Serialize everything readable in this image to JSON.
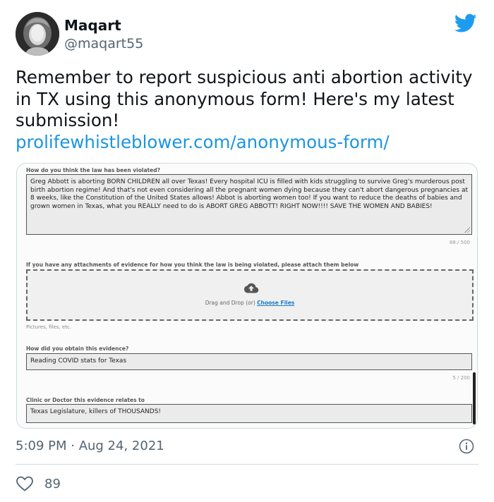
{
  "author": {
    "display_name": "Maqart",
    "handle": "@maqart55"
  },
  "tweet": {
    "text": "Remember to report suspicious anti abortion activity in TX using this anonymous form! Here's my latest submission!",
    "link": "prolifewhistleblower.com/anonymous-form/",
    "timestamp": "5:09 PM · Aug 24, 2021",
    "like_count": "89"
  },
  "form": {
    "q1_label": "How do you think the law has been violated?",
    "q1_answer": "Greg Abbott is aborting BORN CHILDREN all over Texas! Every hospital ICU is filled with kids struggling to survive Greg's murderous post birth abortion regime! And that's not even considering all the pregnant women dying because they can't abort dangerous pregnancies at 8 weeks, like the Constitution of the United States allows! Abbot is aborting women too!  If you want to reduce the deaths of babies and grown women in Texas, what you REALLY need to do is ABORT GREG ABBOTT! RIGHT NOW!!!! SAVE THE WOMEN AND BABIES!",
    "q1_counter": "88 / 500",
    "attach_label": "If you have any attachments of evidence for how you think the law is being violated, please attach them below",
    "drop_text": "Drag and Drop (or)",
    "choose_files": "Choose Files",
    "attach_hint": "Pictures, files, etc.",
    "q2_label": "How did you obtain this evidence?",
    "q2_answer": "Reading COVID stats for Texas",
    "q2_counter": "5 / 200",
    "q3_label": "Clinic or Doctor this evidence relates to",
    "q3_answer": "Texas Legislature, killers of THOUSANDS!"
  },
  "colors": {
    "twitter_blue": "#1d9bf0",
    "link_blue": "#1b95e0",
    "secondary_text": "#536471"
  },
  "icons": [
    "twitter-bird-icon",
    "cloud-upload-icon",
    "info-icon",
    "heart-icon"
  ]
}
